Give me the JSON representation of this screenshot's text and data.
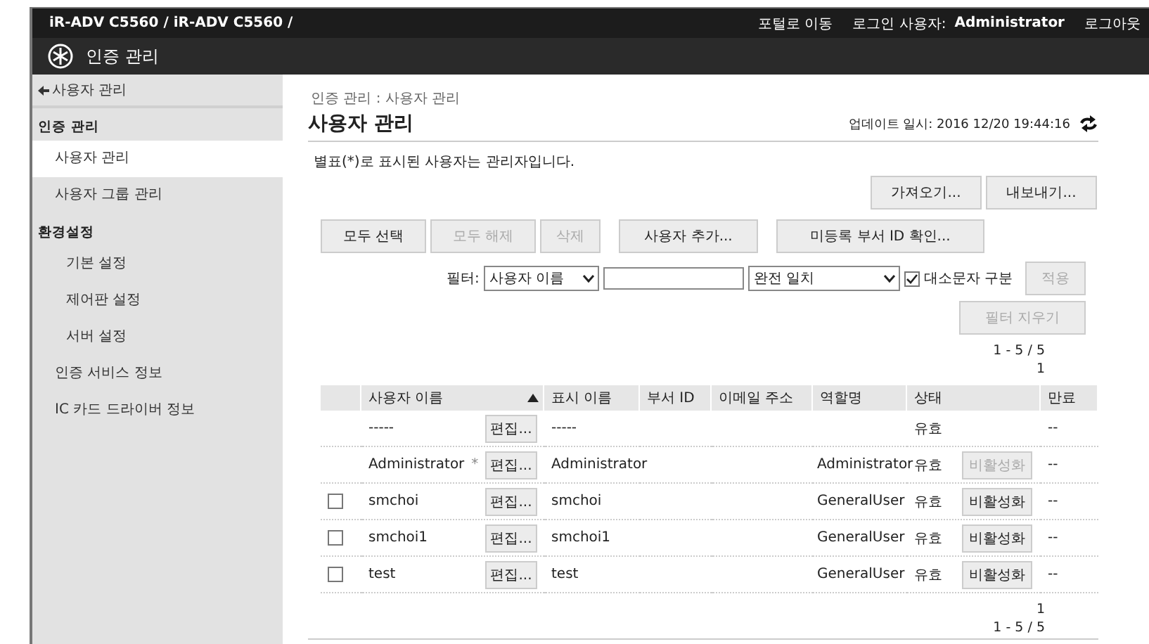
{
  "top_bar": {
    "path": "iR-ADV C5560 / iR-ADV C5560 /",
    "links": [
      {
        "label": "포털로 이동"
      }
    ],
    "login_label": "로그인 사용자:",
    "login_user": "Administrator",
    "logout": "로그아웃"
  },
  "app_bar": {
    "title": "인증 관리"
  },
  "sidebar": {
    "back": "사용자 관리",
    "sections": [
      {
        "title": "인증 관리",
        "items": [
          {
            "label": "사용자 관리",
            "selected": true,
            "indent": false
          },
          {
            "label": "사용자 그룹 관리",
            "selected": false,
            "indent": false
          }
        ]
      },
      {
        "title": "환경설정",
        "items": [
          {
            "label": "기본 설정",
            "selected": false,
            "indent": true
          },
          {
            "label": "제어판 설정",
            "selected": false,
            "indent": true
          },
          {
            "label": "서버 설정",
            "selected": false,
            "indent": true
          },
          {
            "label": "인증 서비스 정보",
            "selected": false,
            "indent": false
          },
          {
            "label": "IC 카드 드라이버 정보",
            "selected": false,
            "indent": false
          }
        ]
      }
    ]
  },
  "breadcrumb": "인증 관리 : 사용자 관리",
  "title": "사용자 관리",
  "updated": "업데이트 일시: 2016 12/20 19:44:16",
  "note": "별표(*)로 표시된 사용자는 관리자입니다.",
  "io_buttons": [
    {
      "label": "가져오기...",
      "disabled": false
    },
    {
      "label": "내보내기...",
      "disabled": false
    }
  ],
  "action_buttons": [
    {
      "label": "모두 선택",
      "disabled": false
    },
    {
      "label": "모두 해제",
      "disabled": true
    },
    {
      "label": "삭제",
      "disabled": true
    },
    {
      "label": "사용자 추가...",
      "disabled": false
    },
    {
      "label": "미등록 부서 ID 확인...",
      "disabled": false
    }
  ],
  "filter": {
    "label": "필터:",
    "field": "사용자 이름",
    "match": "완전 일치",
    "case_label": "대소문자 구분",
    "case_checked": true,
    "apply": {
      "label": "적용",
      "disabled": true
    },
    "clear": {
      "label": "필터 지우기",
      "disabled": true
    }
  },
  "pager_top": {
    "range": "1 - 5 / 5",
    "page": "1"
  },
  "table": {
    "columns": [
      "사용자 이름",
      "표시 이름",
      "부서 ID",
      "이메일 주소",
      "역할명",
      "상태",
      "만료"
    ],
    "rows": [
      {
        "name": "-----",
        "edit": "편집...",
        "display": "-----",
        "status": "유효",
        "expiry": "--"
      },
      {
        "name": "Administrator",
        "admin_mark": "*",
        "edit": "편집...",
        "display": "Administrator",
        "role": "Administrator",
        "status": "유효",
        "deactivate": {
          "label": "비활성화",
          "disabled": true
        },
        "expiry": "--"
      },
      {
        "checked": false,
        "name": "smchoi",
        "edit": "편집...",
        "display": "smchoi",
        "role": "GeneralUser",
        "status": "유효",
        "deactivate": {
          "label": "비활성화",
          "disabled": false
        },
        "expiry": "--"
      },
      {
        "checked": false,
        "name": "smchoi1",
        "edit": "편집...",
        "display": "smchoi1",
        "role": "GeneralUser",
        "status": "유효",
        "deactivate": {
          "label": "비활성화",
          "disabled": false
        },
        "expiry": "--"
      },
      {
        "checked": false,
        "name": "test",
        "edit": "편집...",
        "display": "test",
        "role": "GeneralUser",
        "status": "유효",
        "deactivate": {
          "label": "비활성화",
          "disabled": false
        },
        "expiry": "--"
      }
    ]
  },
  "pager_bottom": {
    "page": "1",
    "range": "1 - 5 / 5"
  }
}
